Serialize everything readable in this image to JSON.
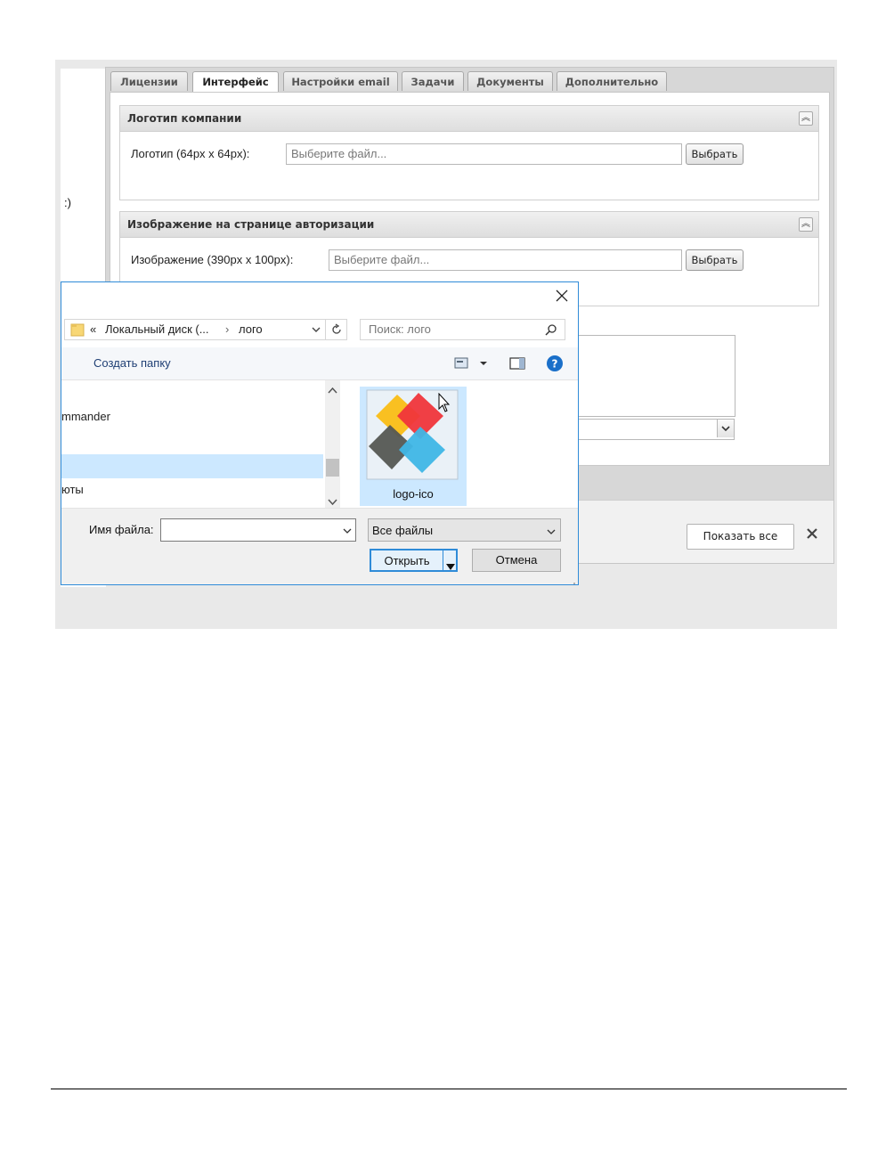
{
  "tabs": [
    {
      "label": "Лицензии",
      "active": false
    },
    {
      "label": "Интерфейс",
      "active": true
    },
    {
      "label": "Настройки email",
      "active": false
    },
    {
      "label": "Задачи",
      "active": false
    },
    {
      "label": "Документы",
      "active": false
    },
    {
      "label": "Дополнительно",
      "active": false
    }
  ],
  "left_strip_text": ":)",
  "logo_section": {
    "title": "Логотип компании",
    "label": "Логотип (64px x 64px):",
    "placeholder": "Выберите файл...",
    "button": "Выбрать"
  },
  "auth_section": {
    "title": "Изображение на странице авторизации",
    "label": "Изображение (390px x 100px):",
    "placeholder": "Выберите файл...",
    "button": "Выбрать"
  },
  "bottom_bar": {
    "show_all": "Показать все"
  },
  "dialog": {
    "address": {
      "prefix": "«",
      "segment1": "Локальный диск (...",
      "separator": "›",
      "segment2": "лого"
    },
    "search_placeholder": "Поиск: лого",
    "new_folder": "Создать папку",
    "nav_items": [
      {
        "label": "mmander",
        "selected": false
      },
      {
        "label": "",
        "selected": true
      },
      {
        "label": "юты",
        "selected": false
      }
    ],
    "file": {
      "name": "logo-ico"
    },
    "filename_label": "Имя файла:",
    "filename_value": "",
    "filter_value": "Все файлы",
    "open_button": "Открыть",
    "cancel_button": "Отмена"
  },
  "colors": {
    "accent": "#2f8bd8",
    "selection": "#cce8ff",
    "logo_yellow": "#f9c021",
    "logo_red": "#f0353b",
    "logo_gray": "#555753",
    "logo_blue": "#3fb6e6"
  }
}
